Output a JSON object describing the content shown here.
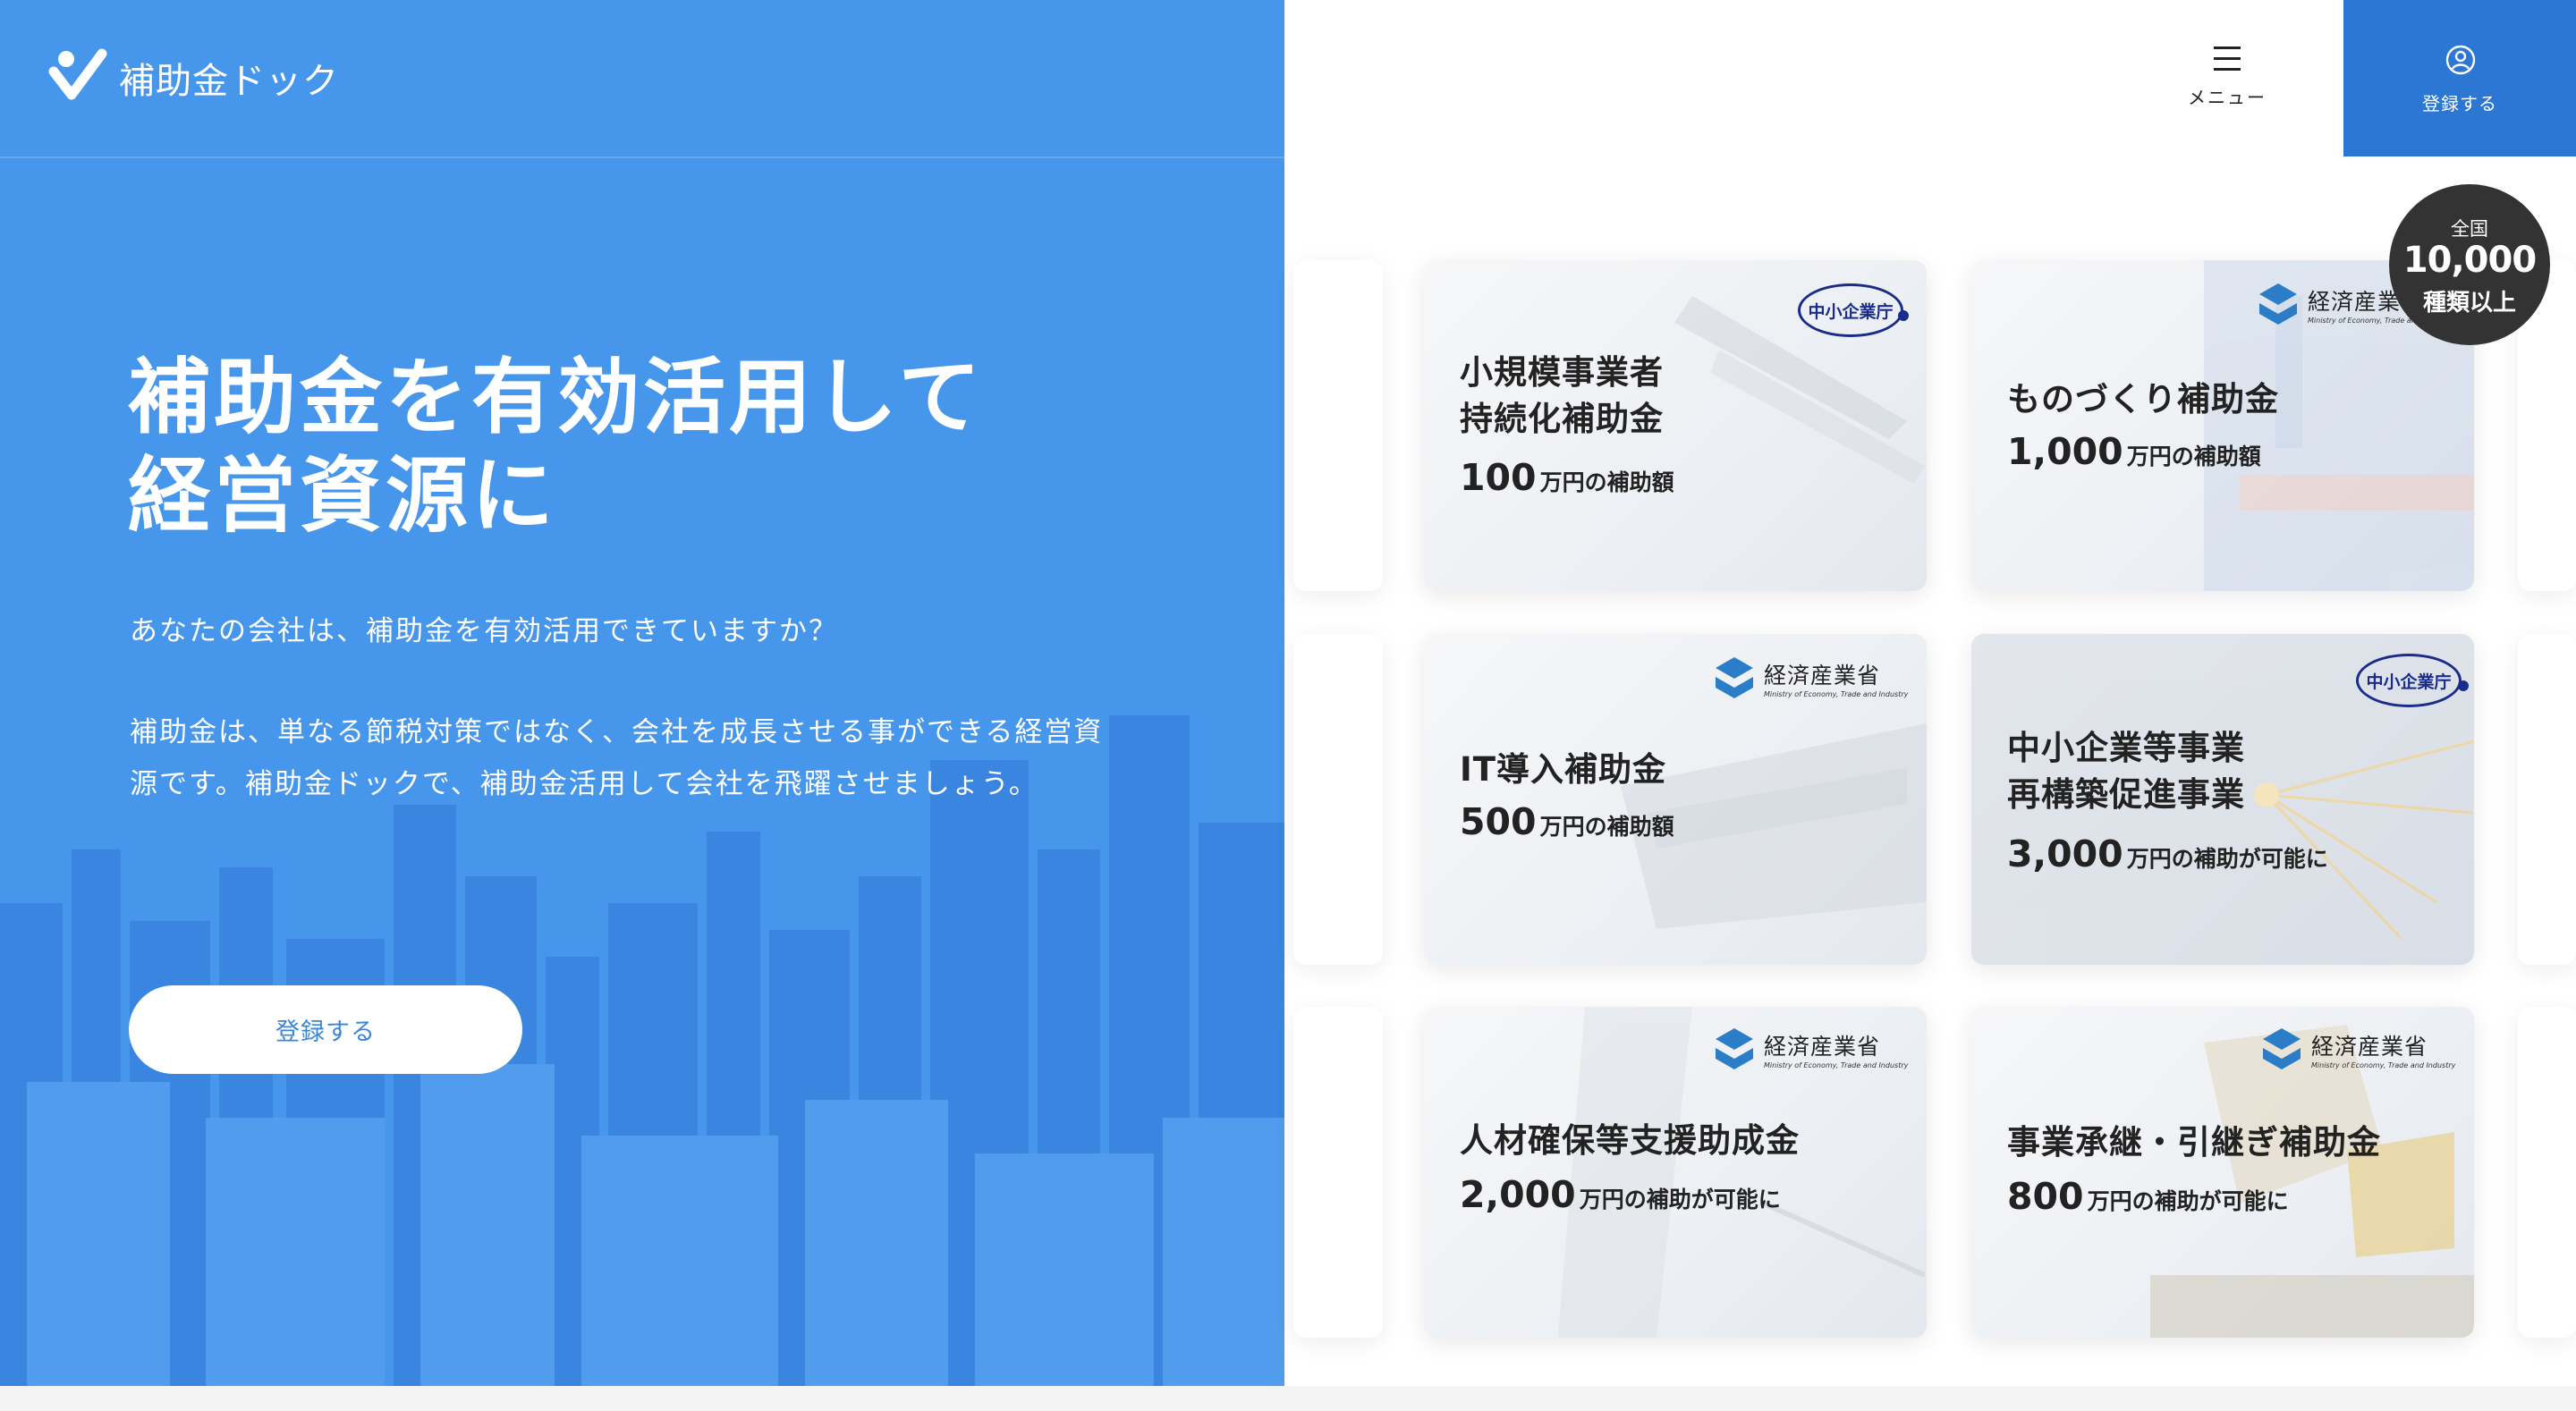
{
  "header": {
    "logo_text": "補助金ドック",
    "menu_label": "メニュー",
    "register_label": "登録する"
  },
  "hero": {
    "title_line1": "補助金を有効活用して",
    "title_line2": "経営資源に",
    "question": "あなたの会社は、補助金を有効活用できていますか？",
    "desc_line1": "補助金は、単なる節税対策ではなく、会社を成長させる事ができる経営資",
    "desc_line2": "源です。補助金ドックで、補助金活用して会社を飛躍させましょう。",
    "cta_label": "登録する"
  },
  "badge": {
    "line1": "全国",
    "line2": "10,000",
    "line3": "種類以上"
  },
  "cards": [
    {
      "title_line1": "小規模事業者",
      "title_line2": "持続化補助金",
      "amount": "100",
      "suffix": "万円の補助額",
      "agency": "中小企業庁"
    },
    {
      "title_line1": "ものづくり補助金",
      "title_line2": "",
      "amount": "1,000",
      "suffix": "万円の補助額",
      "agency": "経済産業省"
    },
    {
      "title_line1": "IT導入補助金",
      "title_line2": "",
      "amount": "500",
      "suffix": "万円の補助額",
      "agency": "経済産業省"
    },
    {
      "title_line1": "中小企業等事業",
      "title_line2": "再構築促進事業",
      "amount": "3,000",
      "suffix": "万円の補助が可能に",
      "agency": "中小企業庁"
    },
    {
      "title_line1": "人材確保等支援助成金",
      "title_line2": "",
      "amount": "2,000",
      "suffix": "万円の補助が可能に",
      "agency": "経済産業省"
    },
    {
      "title_line1": "事業承継・引継ぎ補助金",
      "title_line2": "",
      "amount": "800",
      "suffix": "万円の補助が可能に",
      "agency": "経済産業省"
    }
  ],
  "agency_en": "Ministry of Economy, Trade and Industry",
  "colors": {
    "hero_blue": "#4696ec",
    "register_blue": "#2d77d4",
    "badge_dark": "#333333",
    "chusho_navy": "#1a2c8a"
  }
}
